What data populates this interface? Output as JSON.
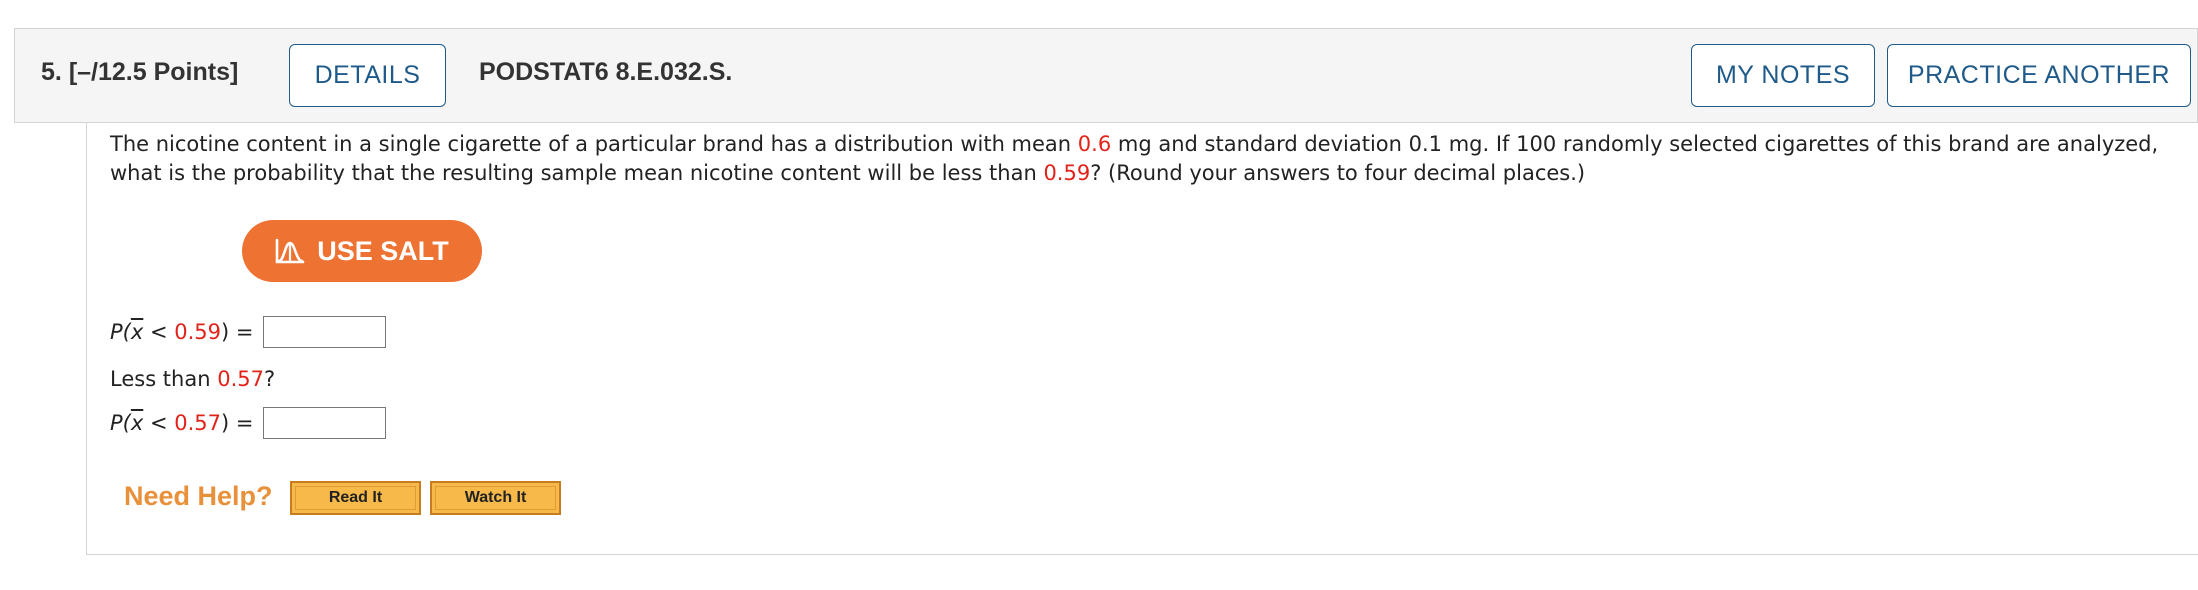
{
  "header": {
    "question_number": "5.",
    "points": "[–/12.5 Points]",
    "details_label": "DETAILS",
    "problem_code": "PODSTAT6 8.E.032.S.",
    "my_notes_label": "MY NOTES",
    "practice_label": "PRACTICE ANOTHER"
  },
  "question": {
    "part1": "The nicotine content in a single cigarette of a particular brand has a distribution with mean ",
    "mean": "0.6",
    "part2": " mg and standard deviation 0.1 mg. If 100 randomly selected cigarettes of this brand are analyzed, what is the probability that the resulting sample mean nicotine content will be less than ",
    "threshold1": "0.59",
    "part3": "? (Round your answers to four decimal places.)"
  },
  "salt": {
    "label": "USE SALT",
    "icon": "normal-curve-icon"
  },
  "answer1": {
    "prefix": "P(",
    "variable": "x",
    "operator": " < ",
    "value": "0.59",
    "suffix": ") =",
    "input_value": ""
  },
  "less_than": {
    "prefix": "Less than ",
    "value": "0.57",
    "suffix": "?"
  },
  "answer2": {
    "prefix": "P(",
    "variable": "x",
    "operator": " < ",
    "value": "0.57",
    "suffix": ") =",
    "input_value": ""
  },
  "help": {
    "label": "Need Help?",
    "read_it_label": "Read It",
    "watch_it_label": "Watch It"
  },
  "colors": {
    "accent_blue": "#1f5a89",
    "salt_orange": "#ee7232",
    "value_red": "#e2231a",
    "help_orange": "#e8913a"
  }
}
